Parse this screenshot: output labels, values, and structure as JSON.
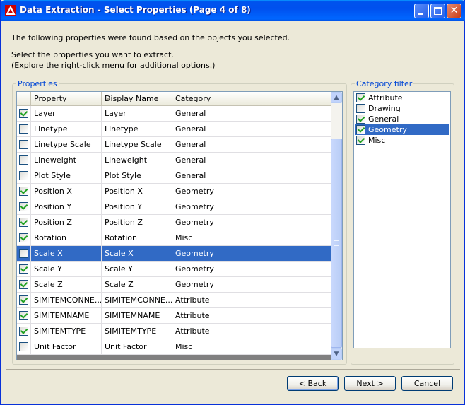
{
  "window": {
    "title": "Data Extraction - Select Properties (Page 4 of 8)"
  },
  "intro": {
    "line1": "The following properties were found based on the objects you selected.",
    "line2": "Select the properties you want to extract.",
    "line3": "(Explore the right-click menu for additional options.)"
  },
  "properties": {
    "group_title": "Properties",
    "columns": [
      "Property",
      "Display Name",
      "Category"
    ],
    "rows": [
      {
        "checked": true,
        "property": "Layer",
        "display": "Layer",
        "category": "General"
      },
      {
        "checked": false,
        "property": "Linetype",
        "display": "Linetype",
        "category": "General"
      },
      {
        "checked": false,
        "property": "Linetype Scale",
        "display": "Linetype Scale",
        "category": "General"
      },
      {
        "checked": false,
        "property": "Lineweight",
        "display": "Lineweight",
        "category": "General"
      },
      {
        "checked": false,
        "property": "Plot Style",
        "display": "Plot Style",
        "category": "General"
      },
      {
        "checked": true,
        "property": "Position X",
        "display": "Position X",
        "category": "Geometry"
      },
      {
        "checked": true,
        "property": "Position Y",
        "display": "Position Y",
        "category": "Geometry"
      },
      {
        "checked": true,
        "property": "Position Z",
        "display": "Position Z",
        "category": "Geometry"
      },
      {
        "checked": true,
        "property": "Rotation",
        "display": "Rotation",
        "category": "Misc"
      },
      {
        "checked": false,
        "property": "Scale X",
        "display": "Scale X",
        "category": "Geometry",
        "selected": true
      },
      {
        "checked": true,
        "property": "Scale Y",
        "display": "Scale Y",
        "category": "Geometry"
      },
      {
        "checked": true,
        "property": "Scale Z",
        "display": "Scale Z",
        "category": "Geometry"
      },
      {
        "checked": true,
        "property": "SIMITEMCONNE...",
        "display": "SIMITEMCONNE...",
        "category": "Attribute"
      },
      {
        "checked": true,
        "property": "SIMITEMNAME",
        "display": "SIMITEMNAME",
        "category": "Attribute"
      },
      {
        "checked": true,
        "property": "SIMITEMTYPE",
        "display": "SIMITEMTYPE",
        "category": "Attribute"
      },
      {
        "checked": false,
        "property": "Unit Factor",
        "display": "Unit Factor",
        "category": "Misc"
      }
    ]
  },
  "category_filter": {
    "group_title": "Category filter",
    "items": [
      {
        "label": "Attribute",
        "checked": true
      },
      {
        "label": "Drawing",
        "checked": false
      },
      {
        "label": "General",
        "checked": true
      },
      {
        "label": "Geometry",
        "checked": true,
        "selected": true
      },
      {
        "label": "Misc",
        "checked": true
      }
    ]
  },
  "buttons": {
    "back": "< Back",
    "next": "Next >",
    "cancel": "Cancel"
  }
}
